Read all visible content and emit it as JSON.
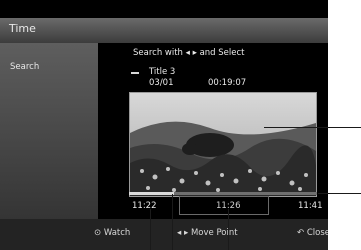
{
  "header": {
    "title": "Time"
  },
  "sidebar": {
    "search_label": "Search"
  },
  "instruction": "Search with ◂ ▸ and Select",
  "recording": {
    "title": "Title 3",
    "date": "03/01",
    "time": "00:19:07"
  },
  "timeline": {
    "start": "11:22",
    "current": "11:26",
    "end": "11:41",
    "progress": 0.24
  },
  "footer": {
    "watch_icon": "⊙",
    "watch_label": "Watch",
    "move_icon": "◂ ▸",
    "move_label": "Move Point",
    "close_icon": "↶",
    "close_label": "Close"
  },
  "icons": [
    "file-icon",
    "watch-icon",
    "arrows-icon",
    "return-icon"
  ],
  "colors": {
    "background": "#000000",
    "panel": "#4a4a4a",
    "text": "#eaeaea"
  }
}
